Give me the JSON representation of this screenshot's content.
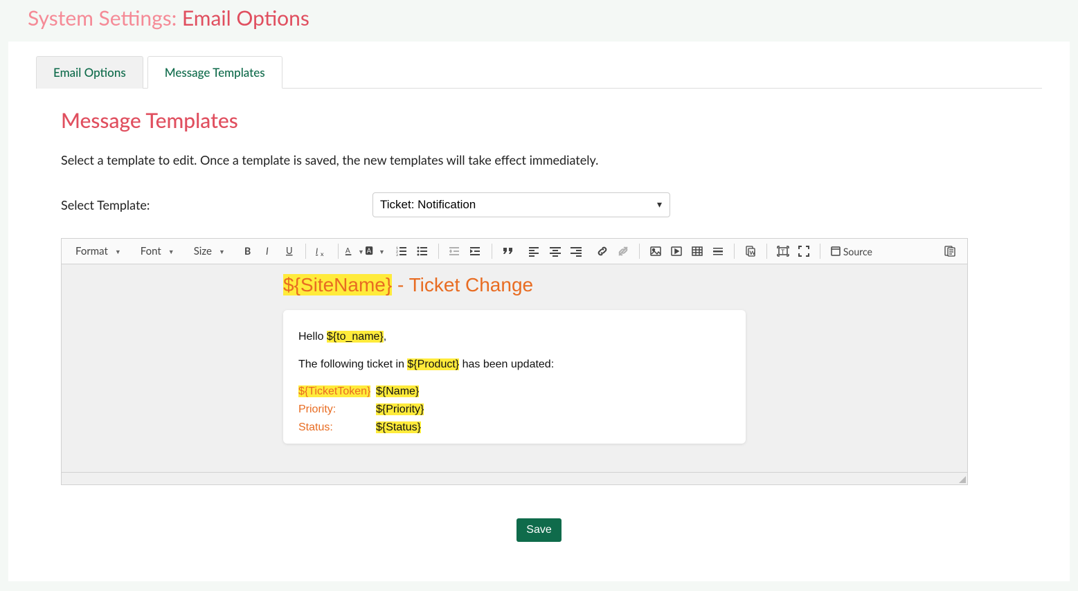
{
  "title_prefix": "System Settings: ",
  "title_emph": "Email Options",
  "tabs": {
    "email_options": "Email Options",
    "message_templates": "Message Templates"
  },
  "section_heading": "Message Templates",
  "description": "Select a template to edit. Once a template is saved, the new templates will take effect immediately.",
  "select_label": "Select Template:",
  "select_value": "Ticket: Notification",
  "toolbar": {
    "format": "Format",
    "font": "Font",
    "size": "Size",
    "source": "Source"
  },
  "email": {
    "title_var": "${SiteName}",
    "title_rest": " - Ticket Change",
    "greeting_pre": "Hello ",
    "greeting_var": "${to_name}",
    "greeting_post": ",",
    "line_pre": "The following ticket in ",
    "line_var": "${Product}",
    "line_post": " has been updated:",
    "rows": [
      {
        "label": "${TicketToken}",
        "label_hl": true,
        "value": "${Name}"
      },
      {
        "label": "Priority:",
        "label_hl": false,
        "value": "${Priority}"
      },
      {
        "label": "Status:",
        "label_hl": false,
        "value": "${Status}"
      }
    ]
  },
  "save_label": "Save"
}
